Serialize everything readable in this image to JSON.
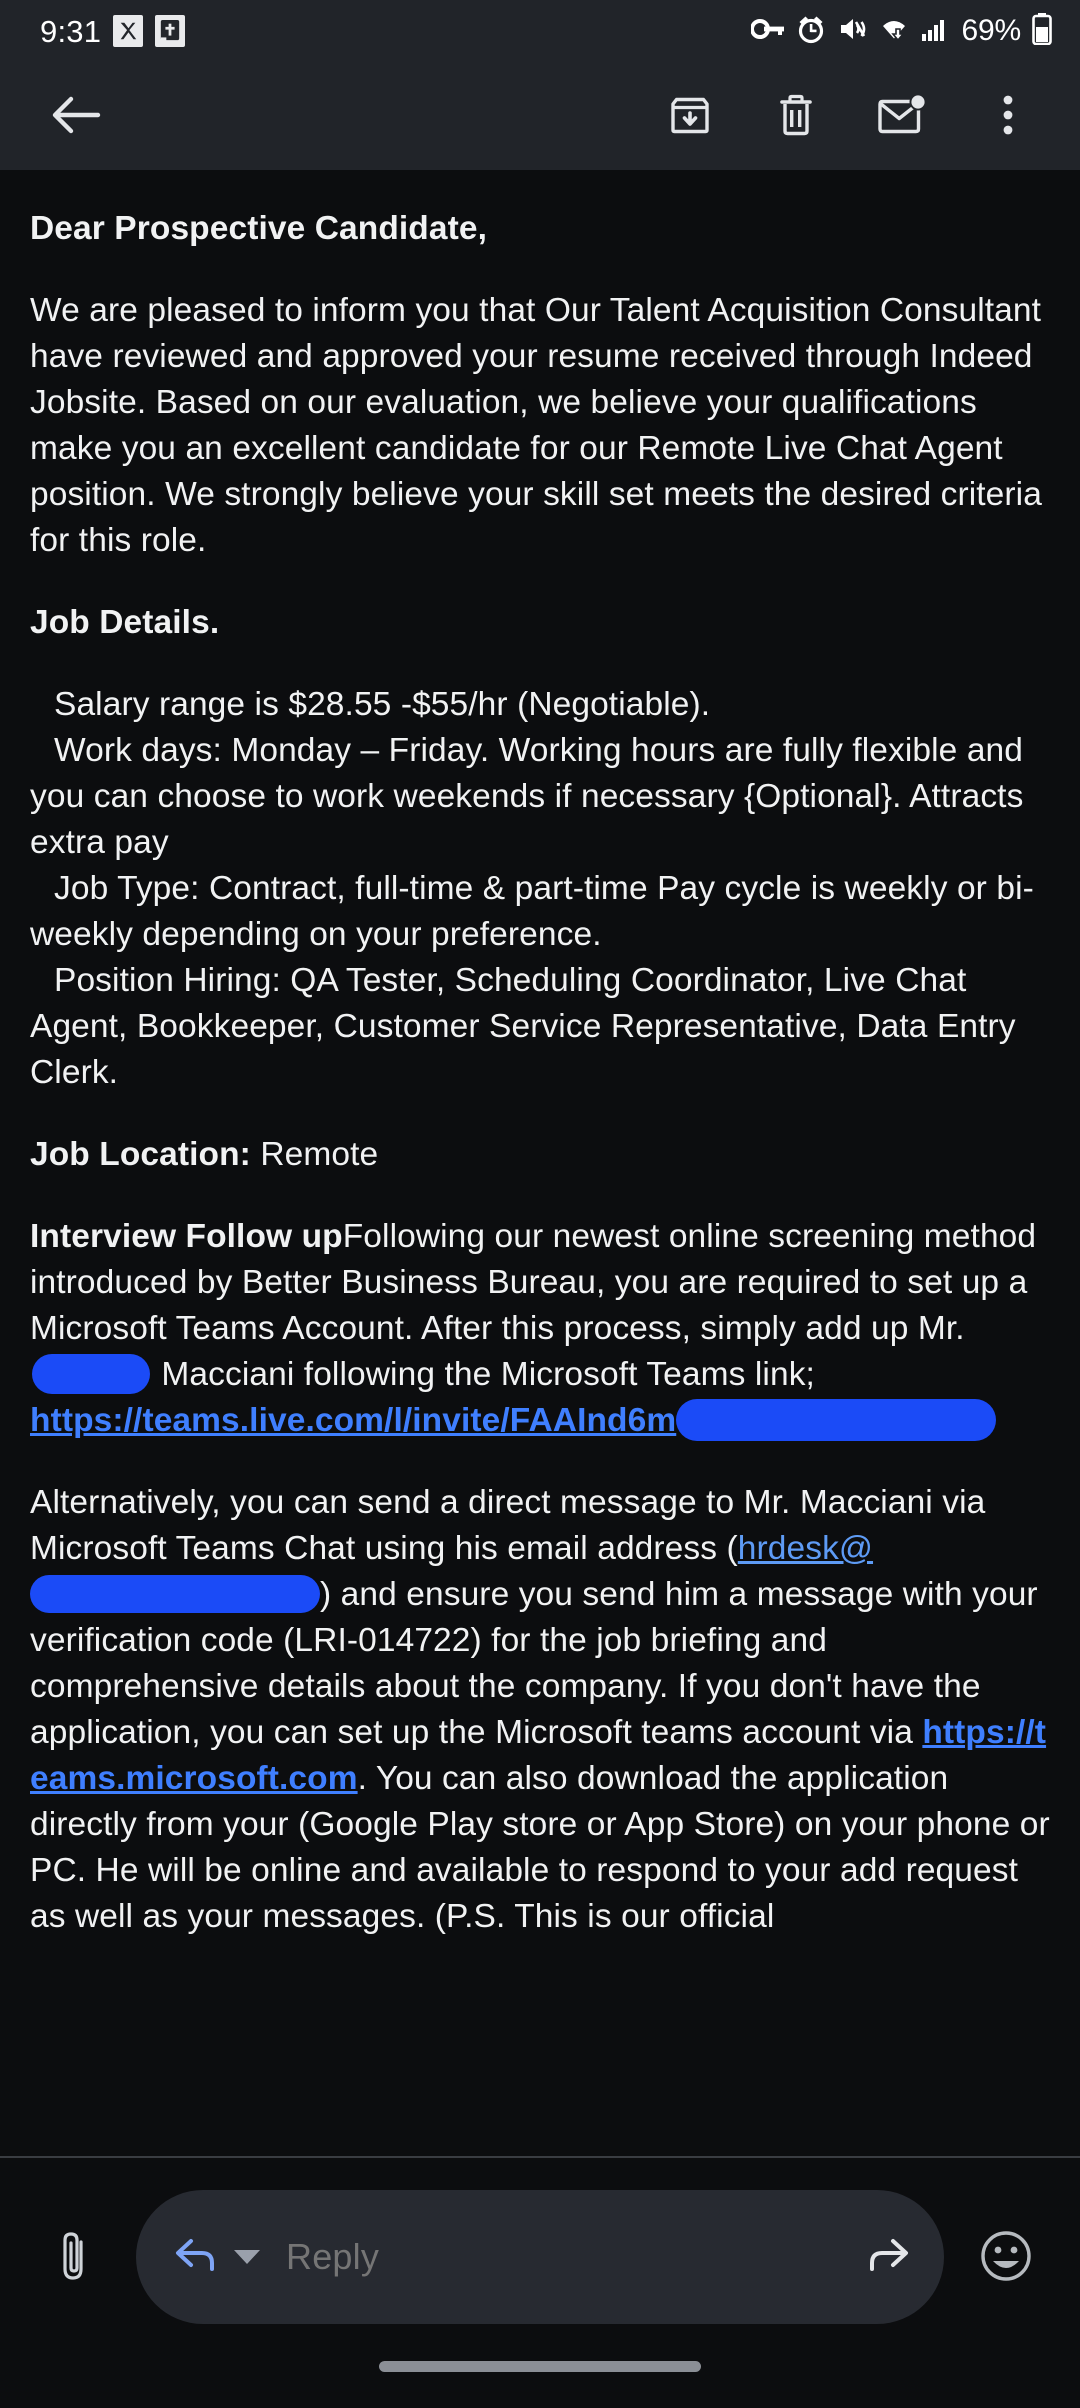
{
  "statusbar": {
    "time": "9:31",
    "battery_percent": "69%",
    "icons": [
      "notification-app-icon",
      "bible-app-icon",
      "vpn-key-icon",
      "alarm-icon",
      "vibrate-mute-icon",
      "wifi-icon",
      "cellular-signal-icon",
      "battery-icon"
    ]
  },
  "actionbar": {
    "back": "back-arrow-icon",
    "archive": "archive-icon",
    "delete": "trash-icon",
    "mark_unread": "mark-unread-envelope-icon",
    "overflow": "more-vertical-icon"
  },
  "email": {
    "greeting": "Dear Prospective Candidate,",
    "para_intro": "We are pleased to inform you that Our Talent Acquisition Consultant have reviewed and approved your resume received through Indeed Jobsite. Based on our evaluation, we believe your qualifications make you an excellent candidate for our Remote Live Chat Agent position. We strongly believe your skill set meets the desired criteria for this role.",
    "job_details_heading": "Job Details.",
    "detail_salary": "Salary range is $28.55 -$55/hr (Negotiable).",
    "detail_workdays": "Work days: Monday – Friday. Working hours are fully flexible and you can choose to work weekends if necessary {Optional}. Attracts extra pay",
    "detail_jobtype": "Job Type: Contract, full-time & part-time Pay cycle is weekly or bi-weekly depending on your preference.",
    "detail_positions": "Position Hiring: QA Tester, Scheduling Coordinator, Live Chat Agent, Bookkeeper, Customer Service Representative, Data Entry Clerk.",
    "job_location_label": "Job Location:",
    "job_location_value": " Remote",
    "followup_label": "Interview Follow up",
    "followup_text_1": "Following our newest online screening method introduced by Better Business Bureau, you are required to set up a Microsoft Teams Account. After this process, simply add up Mr. ",
    "followup_text_2": " Macciani following the Microsoft Teams link;",
    "teams_invite_link": "https://teams.live.com/l/invite/FAAInd6m",
    "alt_text_1": "Alternatively, you can send a direct message to Mr. Macciani via Microsoft Teams Chat using his email address (",
    "email_prefix": "hrdesk@",
    "alt_text_2": ") and ensure you send him a message with your verification code (LRI-014722) for the job briefing and comprehensive details about the company. If you don't have the application, you can set up the Microsoft teams account via ",
    "teams_signup_link": "https://teams.microsoft.com",
    "alt_text_3": ". You can also download the application directly from your (Google Play store or App Store) on your phone or PC. He will be online and available to respond to your add request as well as your messages. (P.S. This is our official"
  },
  "reply": {
    "attach": "paperclip-icon",
    "reply_arrow": "reply-arrow-icon",
    "dropdown": "chevron-down-icon",
    "placeholder": "Reply",
    "forward": "forward-arrow-icon",
    "emoji": "emoji-smiley-icon"
  },
  "colors": {
    "link_bold": "#3f7fff",
    "link_plain": "#5e9bf5",
    "redaction": "#1b4bf7",
    "bar_background": "#212429",
    "page_background": "#0c0d0f"
  }
}
